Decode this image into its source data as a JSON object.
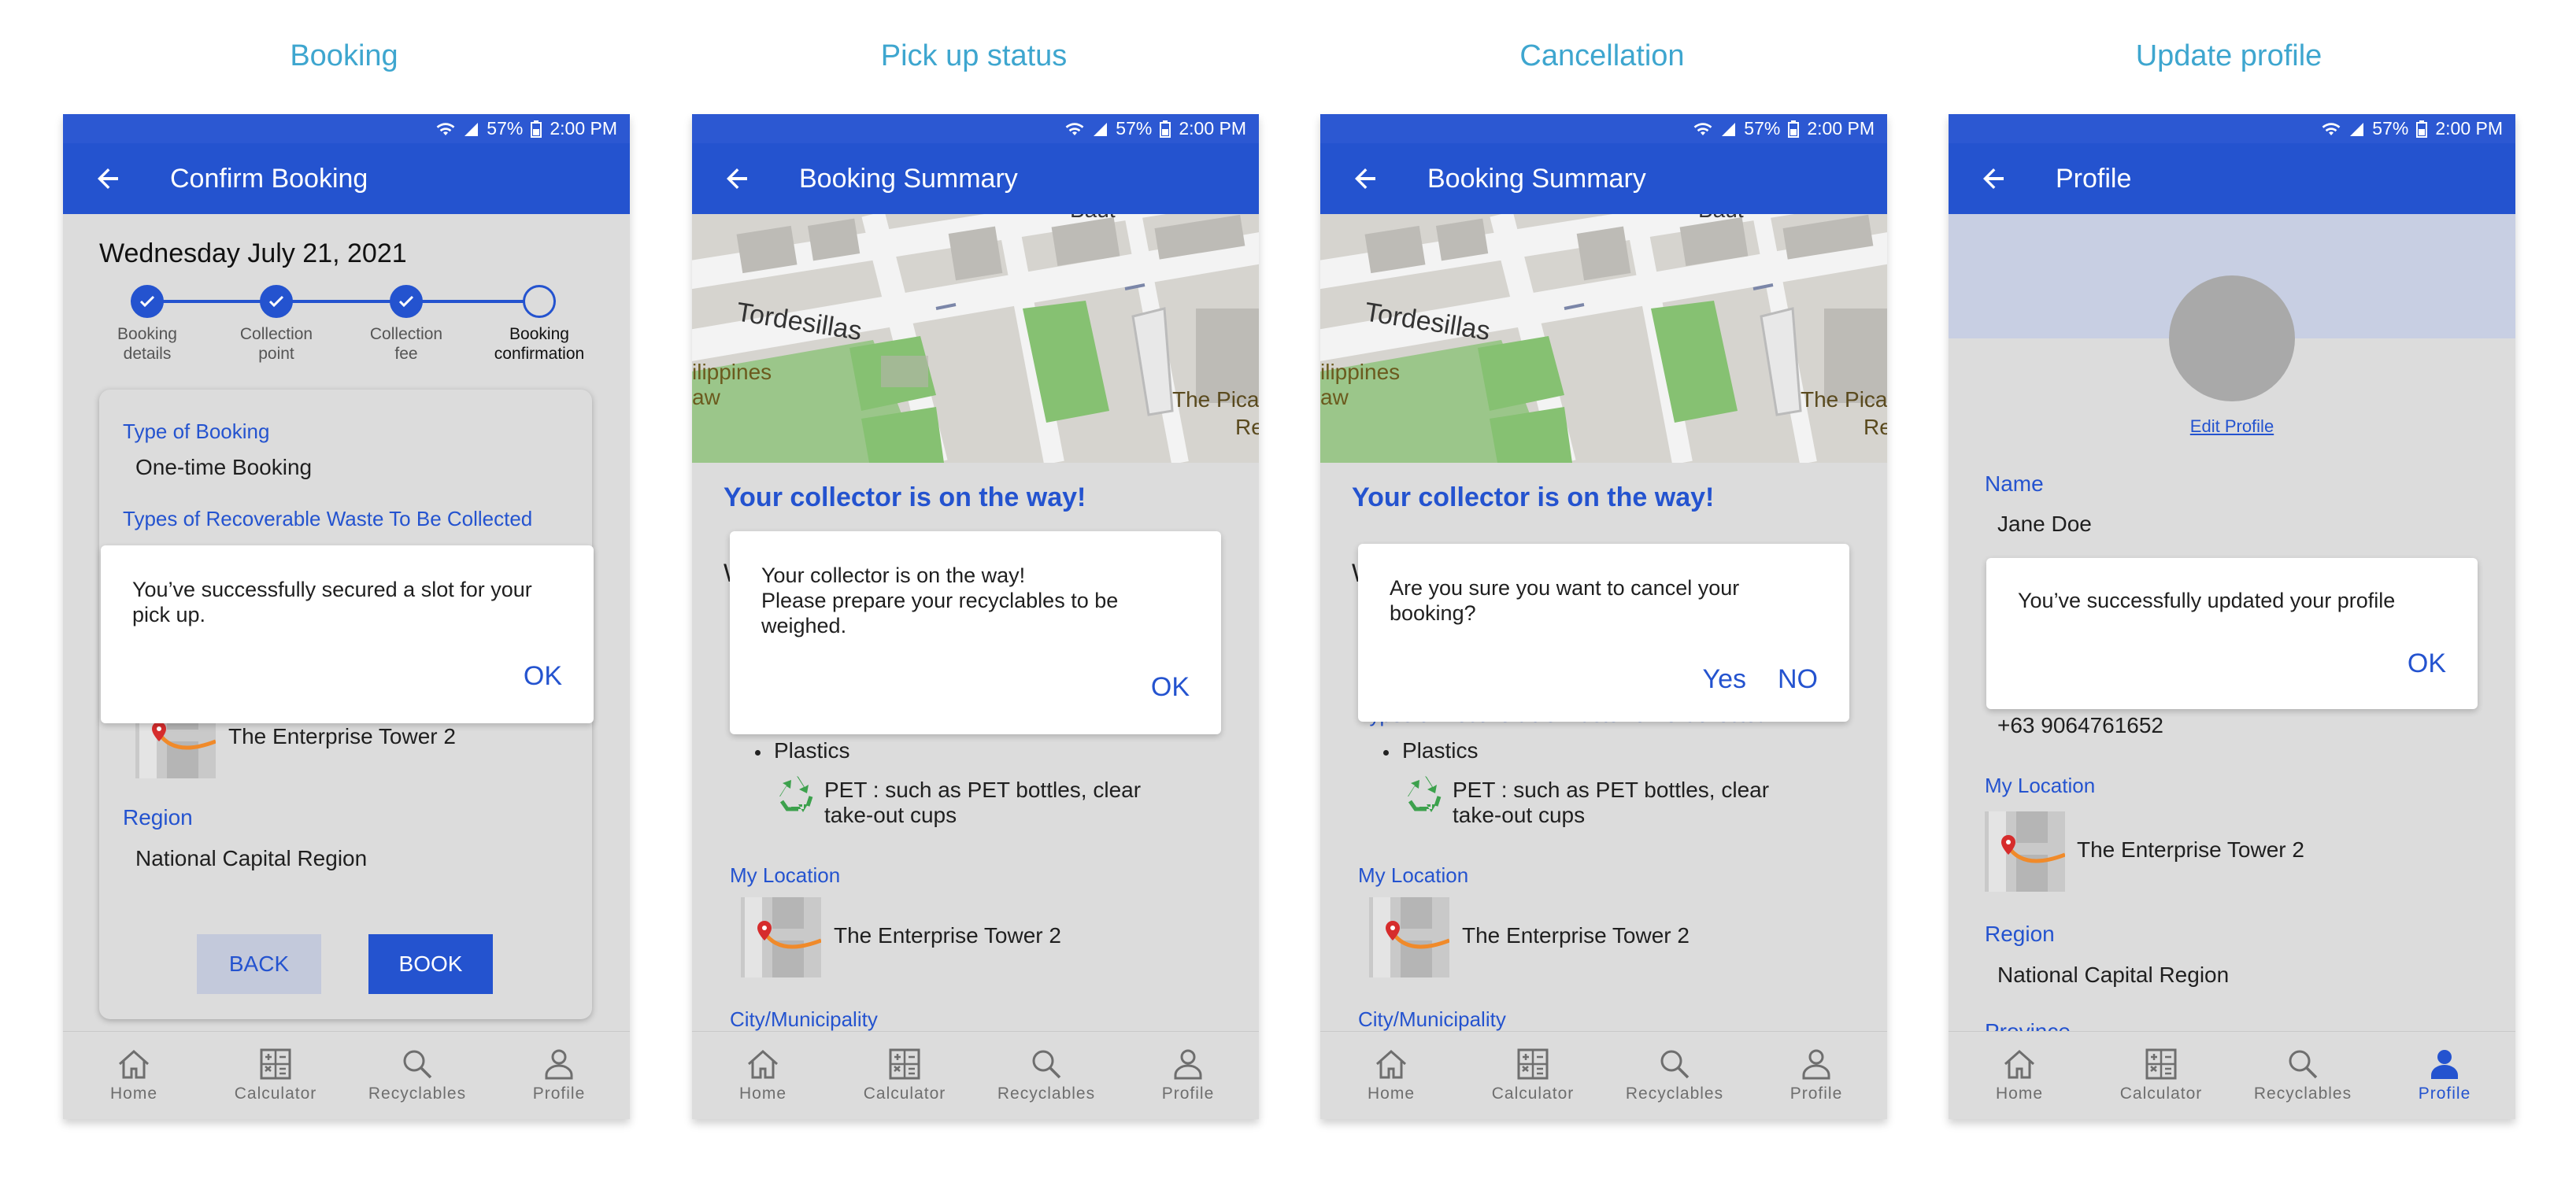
{
  "columns": [
    "Booking",
    "Pick up status",
    "Cancellation",
    "Update profile"
  ],
  "status": {
    "battery": "57%",
    "time": "2:00 PM"
  },
  "nav": [
    "Home",
    "Calculator",
    "Recyclables",
    "Profile"
  ],
  "screen1": {
    "title": "Confirm Booking",
    "date": "Wednesday July 21, 2021",
    "steps": [
      "Booking details",
      "Collection point",
      "Collection fee",
      "Booking confirmation"
    ],
    "type_label": "Type of Booking",
    "type_value": "One-time Booking",
    "waste_label": "Types of Recoverable Waste To Be Collected",
    "location_value": "The Enterprise Tower 2",
    "region_label": "Region",
    "region_value": "National Capital Region",
    "back_btn": "BACK",
    "book_btn": "BOOK",
    "dialog": {
      "message": "You’ve successfully secured a slot for your pick up.",
      "ok": "OK"
    }
  },
  "screen2": {
    "title": "Booking Summary",
    "map_labels": [
      "Tordesillas",
      "ilippines",
      "aw",
      "The Pica",
      "Re",
      "Baut"
    ],
    "heading": "Your collector is on the way!",
    "partial": "W",
    "bullet": "Plastics",
    "pet": "PET : such as PET bottles, clear take-out cups",
    "location_label": "My Location",
    "location_value": "The Enterprise Tower 2",
    "city_label": "City/Municipality",
    "dialog": {
      "line1": "Your collector is on the way!",
      "line2": "Please prepare your recyclables to be weighed.",
      "ok": "OK"
    }
  },
  "screen3": {
    "title": "Booking Summary",
    "heading": "Your collector is on the way!",
    "partial": "W",
    "waste_label_partial": "Types of Recoverable Waste To Be Collected",
    "bullet": "Plastics",
    "pet": "PET : such as PET bottles, clear take-out cups",
    "location_label": "My Location",
    "location_value": "The Enterprise Tower 2",
    "city_label": "City/Municipality",
    "dialog": {
      "message": "Are you sure you want to cancel your booking?",
      "yes": "Yes",
      "no": "NO"
    }
  },
  "screen4": {
    "title": "Profile",
    "edit_link": "Edit Profile",
    "name_label": "Name",
    "name_value": "Jane Doe",
    "phone_value": "+63 9064761652",
    "location_label": "My Location",
    "location_value": "The Enterprise Tower 2",
    "region_label": "Region",
    "region_value": "National Capital Region",
    "province_label": "Province",
    "dialog": {
      "message": "You’ve successfully updated your profile",
      "ok": "OK"
    }
  },
  "colors": {
    "appbar": "#2453cf",
    "statusbar": "#2c58d2",
    "title": "#3ea6cf",
    "accent": "#2453cf"
  },
  "icons": [
    "back-arrow-icon",
    "wifi-icon",
    "signal-icon",
    "battery-icon",
    "home-icon",
    "calculator-icon",
    "search-icon",
    "profile-icon",
    "check-icon",
    "recycle-icon",
    "map-pin-icon"
  ]
}
